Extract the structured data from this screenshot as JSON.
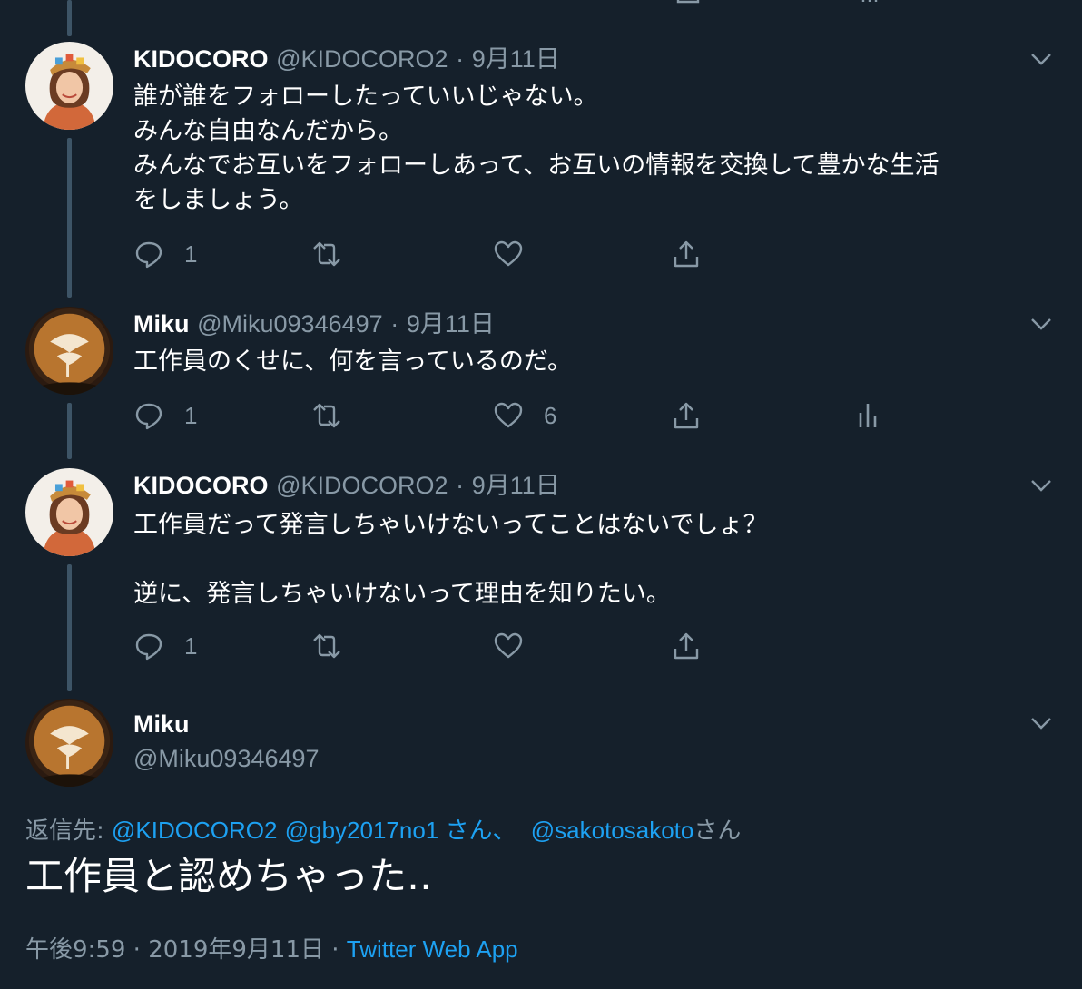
{
  "colors": {
    "background": "#15202b",
    "text": "#ffffff",
    "secondary": "#8899a6",
    "link": "#1da1f2",
    "thread_line": "#3d5466"
  },
  "tweets": [
    {
      "name": "KIDOCORO",
      "handle": "@KIDOCORO2",
      "sep": "·",
      "date": "9月11日",
      "text": "誰が誰をフォローしたっていいじゃない。\nみんな自由なんだから。\nみんなでお互いをフォローしあって、お互いの情報を交換して豊かな生活\nをしましょう。",
      "reply_count": "1",
      "like_count": ""
    },
    {
      "name": "Miku",
      "handle": "@Miku09346497",
      "sep": "·",
      "date": "9月11日",
      "text": "工作員のくせに、何を言っているのだ。",
      "reply_count": "1",
      "like_count": "6"
    },
    {
      "name": "KIDOCORO",
      "handle": "@KIDOCORO2",
      "sep": "·",
      "date": "9月11日",
      "text": "工作員だって発言しちゃいけないってことはないでしょ？\n\n逆に、発言しちゃいけないって理由を知りたい。",
      "reply_count": "1",
      "like_count": ""
    }
  ],
  "main_tweet": {
    "name": "Miku",
    "handle": "@Miku09346497",
    "reply_to_label": "返信先:",
    "mention_1": "@KIDOCORO2",
    "mention_2": "@gby2017no1",
    "mention_2_suffix": " さん、",
    "mention_3": "@sakotosakoto",
    "mention_3_suffix": "さん",
    "text": "工作員と認めちゃった‥",
    "time": "午後9:59",
    "sep": "·",
    "date": "2019年9月11日",
    "sep2": "·",
    "source": "Twitter Web App"
  },
  "icons": [
    "reply-icon",
    "retweet-icon",
    "like-icon",
    "share-icon",
    "analytics-icon",
    "chevron-down-icon"
  ]
}
